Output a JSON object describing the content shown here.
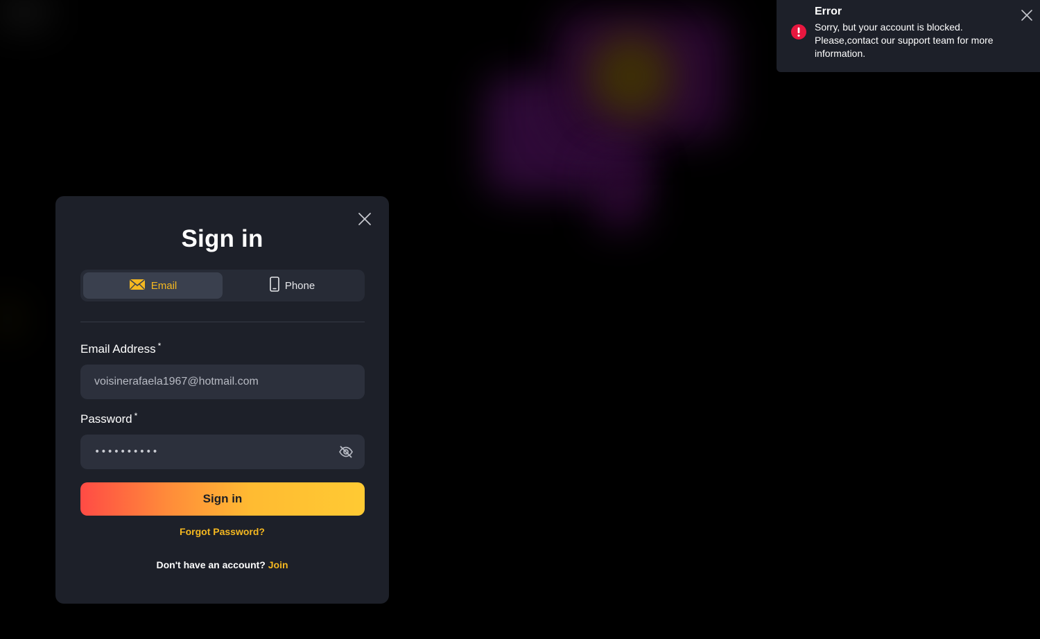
{
  "modal": {
    "title": "Sign in",
    "tabs": [
      {
        "label": "Email",
        "icon": "envelope-icon",
        "active": true
      },
      {
        "label": "Phone",
        "icon": "mobile-phone-icon",
        "active": false
      }
    ],
    "email_field": {
      "label": "Email Address",
      "required_mark": "*",
      "value": "voisinerafaela1967@hotmail.com"
    },
    "password_field": {
      "label": "Password",
      "required_mark": "*",
      "masked_value": "••••••••••",
      "toggle_icon": "eye-slash-icon"
    },
    "submit_label": "Sign in",
    "forgot_label": "Forgot Password?",
    "no_account_text": "Don't have an account?",
    "join_label": "Join",
    "close_icon": "close-icon"
  },
  "toast": {
    "title": "Error",
    "message": "Sorry, but your account is blocked. Please,contact our support team for more information.",
    "icon": "error-exclamation-icon",
    "close_icon": "close-icon"
  },
  "colors": {
    "accent": "#f5b820",
    "modal_bg": "#1d2029",
    "input_bg": "#2c303c",
    "error_red": "#e8173f",
    "button_gradient_start": "#ff4b45",
    "button_gradient_end": "#ffca33"
  }
}
